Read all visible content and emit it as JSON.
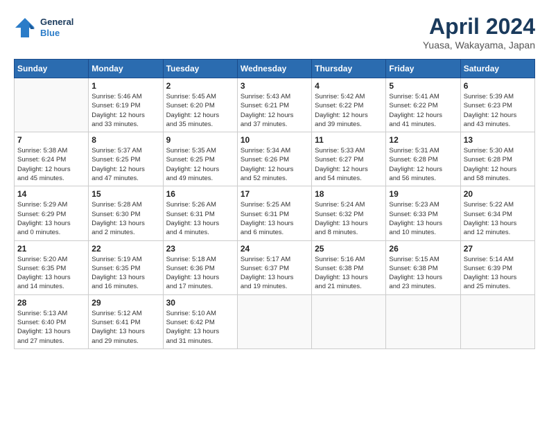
{
  "header": {
    "logo_line1": "General",
    "logo_line2": "Blue",
    "month_title": "April 2024",
    "subtitle": "Yuasa, Wakayama, Japan"
  },
  "weekdays": [
    "Sunday",
    "Monday",
    "Tuesday",
    "Wednesday",
    "Thursday",
    "Friday",
    "Saturday"
  ],
  "weeks": [
    [
      {
        "day": "",
        "info": ""
      },
      {
        "day": "1",
        "info": "Sunrise: 5:46 AM\nSunset: 6:19 PM\nDaylight: 12 hours\nand 33 minutes."
      },
      {
        "day": "2",
        "info": "Sunrise: 5:45 AM\nSunset: 6:20 PM\nDaylight: 12 hours\nand 35 minutes."
      },
      {
        "day": "3",
        "info": "Sunrise: 5:43 AM\nSunset: 6:21 PM\nDaylight: 12 hours\nand 37 minutes."
      },
      {
        "day": "4",
        "info": "Sunrise: 5:42 AM\nSunset: 6:22 PM\nDaylight: 12 hours\nand 39 minutes."
      },
      {
        "day": "5",
        "info": "Sunrise: 5:41 AM\nSunset: 6:22 PM\nDaylight: 12 hours\nand 41 minutes."
      },
      {
        "day": "6",
        "info": "Sunrise: 5:39 AM\nSunset: 6:23 PM\nDaylight: 12 hours\nand 43 minutes."
      }
    ],
    [
      {
        "day": "7",
        "info": "Sunrise: 5:38 AM\nSunset: 6:24 PM\nDaylight: 12 hours\nand 45 minutes."
      },
      {
        "day": "8",
        "info": "Sunrise: 5:37 AM\nSunset: 6:25 PM\nDaylight: 12 hours\nand 47 minutes."
      },
      {
        "day": "9",
        "info": "Sunrise: 5:35 AM\nSunset: 6:25 PM\nDaylight: 12 hours\nand 49 minutes."
      },
      {
        "day": "10",
        "info": "Sunrise: 5:34 AM\nSunset: 6:26 PM\nDaylight: 12 hours\nand 52 minutes."
      },
      {
        "day": "11",
        "info": "Sunrise: 5:33 AM\nSunset: 6:27 PM\nDaylight: 12 hours\nand 54 minutes."
      },
      {
        "day": "12",
        "info": "Sunrise: 5:31 AM\nSunset: 6:28 PM\nDaylight: 12 hours\nand 56 minutes."
      },
      {
        "day": "13",
        "info": "Sunrise: 5:30 AM\nSunset: 6:28 PM\nDaylight: 12 hours\nand 58 minutes."
      }
    ],
    [
      {
        "day": "14",
        "info": "Sunrise: 5:29 AM\nSunset: 6:29 PM\nDaylight: 13 hours\nand 0 minutes."
      },
      {
        "day": "15",
        "info": "Sunrise: 5:28 AM\nSunset: 6:30 PM\nDaylight: 13 hours\nand 2 minutes."
      },
      {
        "day": "16",
        "info": "Sunrise: 5:26 AM\nSunset: 6:31 PM\nDaylight: 13 hours\nand 4 minutes."
      },
      {
        "day": "17",
        "info": "Sunrise: 5:25 AM\nSunset: 6:31 PM\nDaylight: 13 hours\nand 6 minutes."
      },
      {
        "day": "18",
        "info": "Sunrise: 5:24 AM\nSunset: 6:32 PM\nDaylight: 13 hours\nand 8 minutes."
      },
      {
        "day": "19",
        "info": "Sunrise: 5:23 AM\nSunset: 6:33 PM\nDaylight: 13 hours\nand 10 minutes."
      },
      {
        "day": "20",
        "info": "Sunrise: 5:22 AM\nSunset: 6:34 PM\nDaylight: 13 hours\nand 12 minutes."
      }
    ],
    [
      {
        "day": "21",
        "info": "Sunrise: 5:20 AM\nSunset: 6:35 PM\nDaylight: 13 hours\nand 14 minutes."
      },
      {
        "day": "22",
        "info": "Sunrise: 5:19 AM\nSunset: 6:35 PM\nDaylight: 13 hours\nand 16 minutes."
      },
      {
        "day": "23",
        "info": "Sunrise: 5:18 AM\nSunset: 6:36 PM\nDaylight: 13 hours\nand 17 minutes."
      },
      {
        "day": "24",
        "info": "Sunrise: 5:17 AM\nSunset: 6:37 PM\nDaylight: 13 hours\nand 19 minutes."
      },
      {
        "day": "25",
        "info": "Sunrise: 5:16 AM\nSunset: 6:38 PM\nDaylight: 13 hours\nand 21 minutes."
      },
      {
        "day": "26",
        "info": "Sunrise: 5:15 AM\nSunset: 6:38 PM\nDaylight: 13 hours\nand 23 minutes."
      },
      {
        "day": "27",
        "info": "Sunrise: 5:14 AM\nSunset: 6:39 PM\nDaylight: 13 hours\nand 25 minutes."
      }
    ],
    [
      {
        "day": "28",
        "info": "Sunrise: 5:13 AM\nSunset: 6:40 PM\nDaylight: 13 hours\nand 27 minutes."
      },
      {
        "day": "29",
        "info": "Sunrise: 5:12 AM\nSunset: 6:41 PM\nDaylight: 13 hours\nand 29 minutes."
      },
      {
        "day": "30",
        "info": "Sunrise: 5:10 AM\nSunset: 6:42 PM\nDaylight: 13 hours\nand 31 minutes."
      },
      {
        "day": "",
        "info": ""
      },
      {
        "day": "",
        "info": ""
      },
      {
        "day": "",
        "info": ""
      },
      {
        "day": "",
        "info": ""
      }
    ]
  ]
}
